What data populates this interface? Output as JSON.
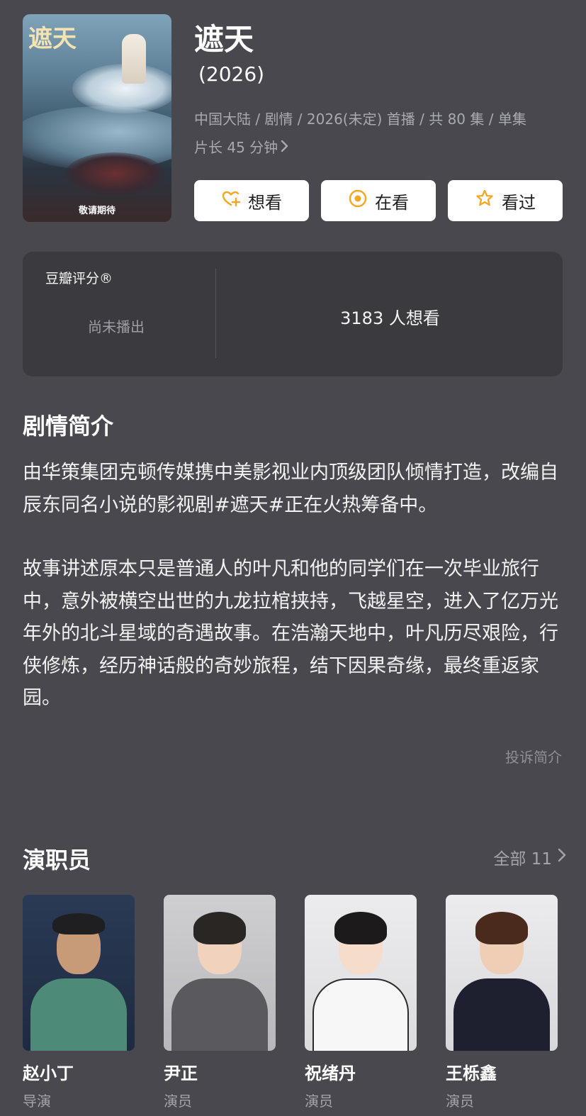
{
  "show": {
    "title": "遮天",
    "year": "(2026)",
    "meta_line1": "中国大陆 / 剧情 / 2026(未定) 首播 / 共 80 集 / 单集",
    "meta_line2": "片长 45 分钟",
    "poster_calligraphy": "遮天",
    "poster_caption": "敬请期待"
  },
  "actions": {
    "want": "想看",
    "watching": "在看",
    "watched": "看过",
    "icon_color": "#f5a623"
  },
  "rating": {
    "label": "豆瓣评分®",
    "status": "尚未播出",
    "want_count": "3183 人想看"
  },
  "synopsis": {
    "heading": "剧情简介",
    "paragraphs": [
      "由华策集团克顿传媒携中美影视业内顶级团队倾情打造，改编自辰东同名小说的影视剧#遮天#正在火热筹备中。",
      "故事讲述原本只是普通人的叶凡和他的同学们在一次毕业旅行中，意外被横空出世的九龙拉棺挟持，飞越星空，进入了亿万光年外的北斗星域的奇遇故事。在浩瀚天地中，叶凡历尽艰险，行侠修炼，经历神话般的奇妙旅程，结下因果奇缘，最终重返家园。"
    ],
    "report_link": "投诉简介"
  },
  "cast": {
    "heading": "演职员",
    "all_label": "全部 11",
    "members": [
      {
        "name": "赵小丁",
        "role": "导演"
      },
      {
        "name": "尹正",
        "role": "演员"
      },
      {
        "name": "祝绪丹",
        "role": "演员"
      },
      {
        "name": "王栎鑫",
        "role": "演员"
      }
    ]
  }
}
